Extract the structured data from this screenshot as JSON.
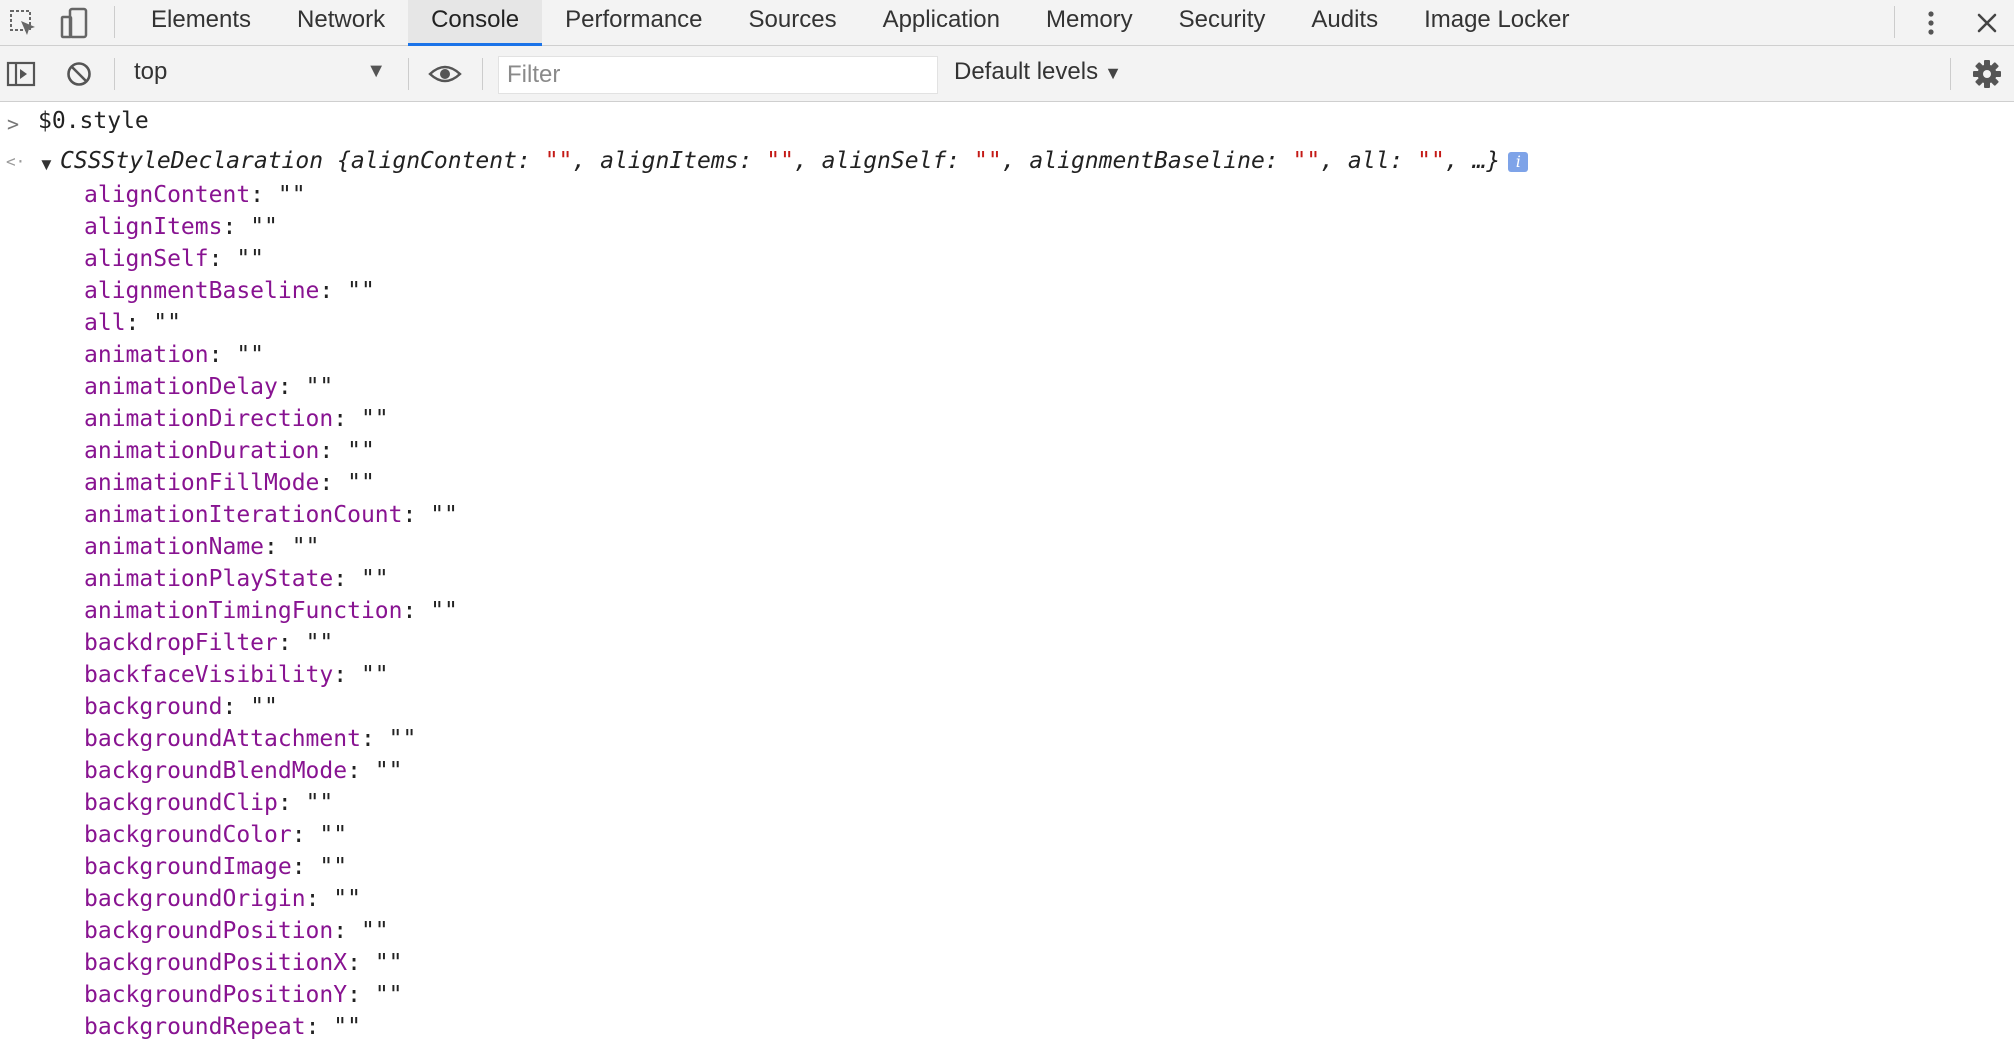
{
  "tabs": [
    "Elements",
    "Network",
    "Console",
    "Performance",
    "Sources",
    "Application",
    "Memory",
    "Security",
    "Audits",
    "Image Locker"
  ],
  "active_tab": "Console",
  "toolbar": {
    "context": "top",
    "filter_placeholder": "Filter",
    "levels_label": "Default levels"
  },
  "console": {
    "command": "$0.style",
    "summary": {
      "type_name": "CSSStyleDeclaration",
      "open_brace": " {",
      "entries": [
        {
          "key": "alignContent",
          "value": "\"\""
        },
        {
          "key": "alignItems",
          "value": "\"\""
        },
        {
          "key": "alignSelf",
          "value": "\"\""
        },
        {
          "key": "alignmentBaseline",
          "value": "\"\""
        },
        {
          "key": "all",
          "value": "\"\""
        }
      ],
      "tail": ", …}"
    },
    "properties": [
      {
        "name": "alignContent",
        "value": "\"\""
      },
      {
        "name": "alignItems",
        "value": "\"\""
      },
      {
        "name": "alignSelf",
        "value": "\"\""
      },
      {
        "name": "alignmentBaseline",
        "value": "\"\""
      },
      {
        "name": "all",
        "value": "\"\""
      },
      {
        "name": "animation",
        "value": "\"\""
      },
      {
        "name": "animationDelay",
        "value": "\"\""
      },
      {
        "name": "animationDirection",
        "value": "\"\""
      },
      {
        "name": "animationDuration",
        "value": "\"\""
      },
      {
        "name": "animationFillMode",
        "value": "\"\""
      },
      {
        "name": "animationIterationCount",
        "value": "\"\""
      },
      {
        "name": "animationName",
        "value": "\"\""
      },
      {
        "name": "animationPlayState",
        "value": "\"\""
      },
      {
        "name": "animationTimingFunction",
        "value": "\"\""
      },
      {
        "name": "backdropFilter",
        "value": "\"\""
      },
      {
        "name": "backfaceVisibility",
        "value": "\"\""
      },
      {
        "name": "background",
        "value": "\"\""
      },
      {
        "name": "backgroundAttachment",
        "value": "\"\""
      },
      {
        "name": "backgroundBlendMode",
        "value": "\"\""
      },
      {
        "name": "backgroundClip",
        "value": "\"\""
      },
      {
        "name": "backgroundColor",
        "value": "\"\""
      },
      {
        "name": "backgroundImage",
        "value": "\"\""
      },
      {
        "name": "backgroundOrigin",
        "value": "\"\""
      },
      {
        "name": "backgroundPosition",
        "value": "\"\""
      },
      {
        "name": "backgroundPositionX",
        "value": "\"\""
      },
      {
        "name": "backgroundPositionY",
        "value": "\"\""
      },
      {
        "name": "backgroundRepeat",
        "value": "\"\""
      }
    ]
  },
  "icons": {
    "inspect": "inspect-element-icon",
    "device": "device-toolbar-icon",
    "more": "more-vertical-icon",
    "close": "close-icon",
    "sidebar": "show-sidebar-icon",
    "clear": "clear-console-icon",
    "live_expression": "eye-icon",
    "settings": "gear-icon",
    "info": "info-icon"
  },
  "colors": {
    "property_name": "#881391",
    "string_value": "#c41a16",
    "active_tab_underline": "#1a73e8",
    "info_badge": "#7ea3e8"
  }
}
